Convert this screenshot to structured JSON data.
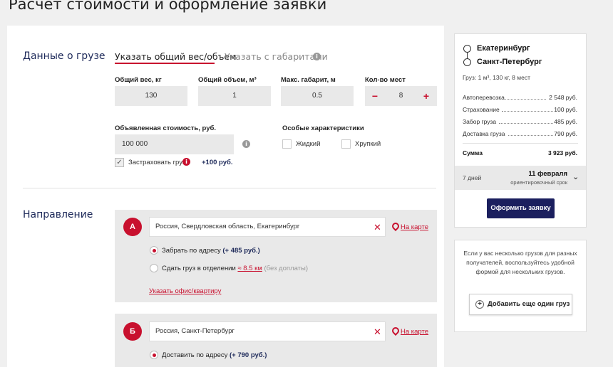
{
  "page": {
    "title": "Расчет стоимости и оформление заявки"
  },
  "cargo": {
    "section_title": "Данные о грузе",
    "tabs": [
      {
        "label": "Указать общий вес/объем",
        "active": true
      },
      {
        "label": "Указать с габаритами",
        "active": false
      }
    ],
    "fields": {
      "weight_label": "Общий вес, кг",
      "weight_value": "130",
      "volume_label": "Общий объем, м³",
      "volume_value": "1",
      "max_dim_label": "Макс. габарит, м",
      "max_dim_value": "0.5",
      "places_label": "Кол-во мест",
      "places_value": "8",
      "minus": "−",
      "plus": "+"
    },
    "declared_value_label": "Объявленная стоимость, руб.",
    "declared_value": "100 000",
    "special_label": "Особые характеристики",
    "special_options": [
      "Жидкий",
      "Хрупкий"
    ],
    "insure_label": "Застраховать груз",
    "insure_checked": true,
    "insure_price": "+100 руб."
  },
  "direction": {
    "section_title": "Направление",
    "points": [
      {
        "badge": "А",
        "address": "Россия, Свердловская область, Екатеринбург",
        "map_link": "На карте",
        "option1_label": "Забрать по адресу",
        "option1_price": "(+ 485 руб.)",
        "option2_label": "Сдать груз в отделении",
        "option2_distance": "≈ 8.5 км",
        "option2_note": "(без доплаты)",
        "office_link": "Указать офис/квартиру"
      },
      {
        "badge": "Б",
        "address": "Россия, Санкт-Петербург",
        "map_link": "На карте",
        "option1_label": "Доставить по адресу",
        "option1_price": "(+ 790 руб.)"
      }
    ]
  },
  "summary": {
    "from_city": "Екатеринбург",
    "to_city": "Санкт-Петербург",
    "cargo_info": "Груз: 1 м³, 130 кг, 8 мест",
    "costs": [
      {
        "label": "Автоперевозка",
        "value": "2 548 руб."
      },
      {
        "label": "Страхование",
        "value": "100 руб."
      },
      {
        "label": "Забор груза",
        "value": "485 руб."
      },
      {
        "label": "Доставка груза",
        "value": "790 руб."
      }
    ],
    "total_label": "Сумма",
    "total_value": "3 923 руб.",
    "eta_days": "7 дней",
    "eta_date": "11 февраля",
    "eta_note": "ориентировочный срок",
    "order_button": "Оформить заявку"
  },
  "multi": {
    "text": "Если у вас несколько грузов для разных получателей, воспользуйтесь удобной формой для нескольких грузов.",
    "button": "Добавить еще один груз"
  },
  "colors": {
    "accent": "#c8102e",
    "navy": "#1b1f5e"
  }
}
